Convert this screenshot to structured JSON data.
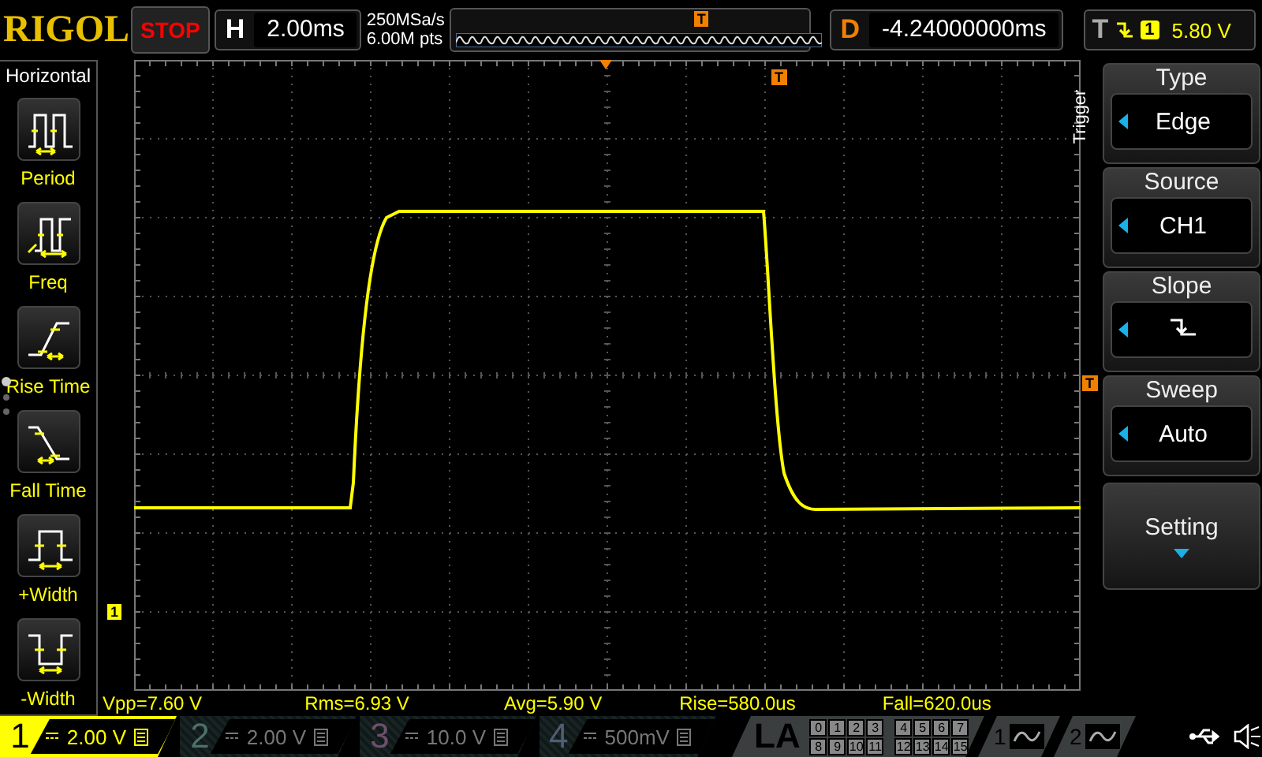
{
  "header": {
    "brand": "RIGOL",
    "run_state": "STOP",
    "timebase_label": "H",
    "timebase": "2.00ms",
    "sample_rate": "250MSa/s",
    "memory_depth": "6.00M pts",
    "overview_marker": "T",
    "delay_label": "D",
    "delay": "-4.24000000ms",
    "trigger_label": "T",
    "trigger_source": "1",
    "trigger_level": "5.80 V"
  },
  "left_menu": {
    "title": "Horizontal",
    "items": [
      {
        "label": "Period",
        "kind": "period"
      },
      {
        "label": "Freq",
        "kind": "freq"
      },
      {
        "label": "Rise Time",
        "kind": "rise"
      },
      {
        "label": "Fall Time",
        "kind": "fall"
      },
      {
        "label": "+Width",
        "kind": "pwidth"
      },
      {
        "label": "-Width",
        "kind": "nwidth"
      }
    ],
    "pages": [
      {
        "selected": true
      },
      {
        "selected": false
      },
      {
        "selected": false
      }
    ]
  },
  "markers": {
    "trigger_position": "T",
    "trigger_level": "T",
    "channel": "1"
  },
  "measurements": [
    "Vpp=7.60 V",
    "Rms=6.93 V",
    "Avg=5.90 V",
    "Rise=580.0us",
    "Fall=620.0us"
  ],
  "channels": [
    {
      "number": "1",
      "scale": "2.00 V",
      "active": true,
      "color": "#ffff00"
    },
    {
      "number": "2",
      "scale": "2.00 V",
      "active": false,
      "color": "#4f6e6c"
    },
    {
      "number": "3",
      "scale": "10.0 V",
      "active": false,
      "color": "#6e4f6c"
    },
    {
      "number": "4",
      "scale": "500mV",
      "active": false,
      "color": "#4f5e74"
    }
  ],
  "la": {
    "label": "LA",
    "bits": [
      "0",
      "1",
      "2",
      "3",
      "4",
      "5",
      "6",
      "7",
      "8",
      "9",
      "10",
      "11",
      "12",
      "13",
      "14",
      "15"
    ]
  },
  "math": [
    {
      "number": "1"
    },
    {
      "number": "2"
    }
  ],
  "trigger_menu": {
    "title": "Trigger",
    "items": [
      {
        "label": "Type",
        "value": "Edge",
        "kind": "select"
      },
      {
        "label": "Source",
        "value": "CH1",
        "kind": "select"
      },
      {
        "label": "Slope",
        "kind": "slope"
      },
      {
        "label": "Sweep",
        "value": "Auto",
        "kind": "select"
      },
      {
        "label": "Setting",
        "kind": "more"
      }
    ]
  }
}
